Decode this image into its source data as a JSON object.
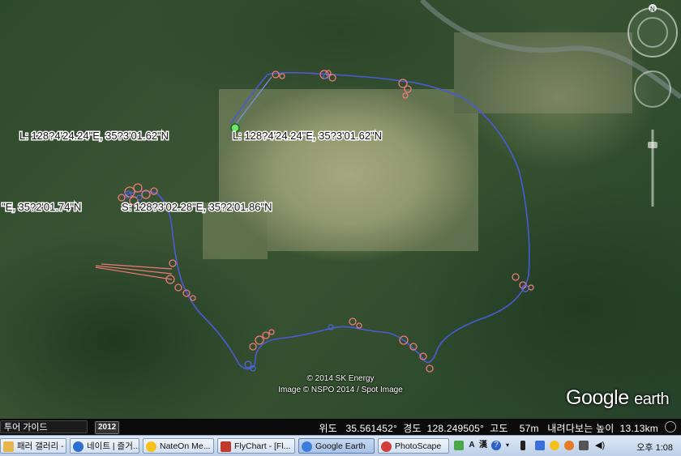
{
  "map": {
    "labels": {
      "label_a": "L: 128?4'24.24\"E, 35?3'01.62\"N",
      "label_b": "L: 128?4'24.24\"E, 35?3'01.62\"N",
      "label_c": "\"E, 35?2'01.74\"N",
      "label_d": "S: 128?3'02.28\"E, 35?2'01.86\"N"
    },
    "credit_line1": "© 2014 SK Energy",
    "credit_line2": "Image © NSPO 2014 / Spot Image",
    "logo_google": "Google",
    "logo_earth": "earth",
    "compass_letter": "N",
    "track_color_main": "#4a5bd6",
    "track_color_alt": "#f07a7a"
  },
  "statusbar": {
    "tour_guide_label": "투어 가이드",
    "year_label": "2012",
    "coords_text": "위도   35.561452°  경도  128.249505°  고도    57m   내려다보는 높이  13.13km"
  },
  "taskbar": {
    "items": [
      {
        "label": "패러 갤러리 - ...",
        "icon": "folder-icon",
        "color": "#e8b54a"
      },
      {
        "label": "네이트 | 즐거...",
        "icon": "ie-icon",
        "color": "#2b6fd1"
      },
      {
        "label": "NateOn Me...",
        "icon": "nateon-icon",
        "color": "#f4c21b"
      },
      {
        "label": "FlyChart - [Fl...",
        "icon": "flychart-icon",
        "color": "#c0392b"
      },
      {
        "label": "Google Earth",
        "icon": "google-earth-icon",
        "color": "#3b7ddd"
      },
      {
        "label": "PhotoScape",
        "icon": "photoscape-icon",
        "color": "#d23c3c"
      }
    ],
    "tray": {
      "ime_a": "A",
      "ime_han": "漢",
      "clock": "오후 1:08"
    }
  }
}
